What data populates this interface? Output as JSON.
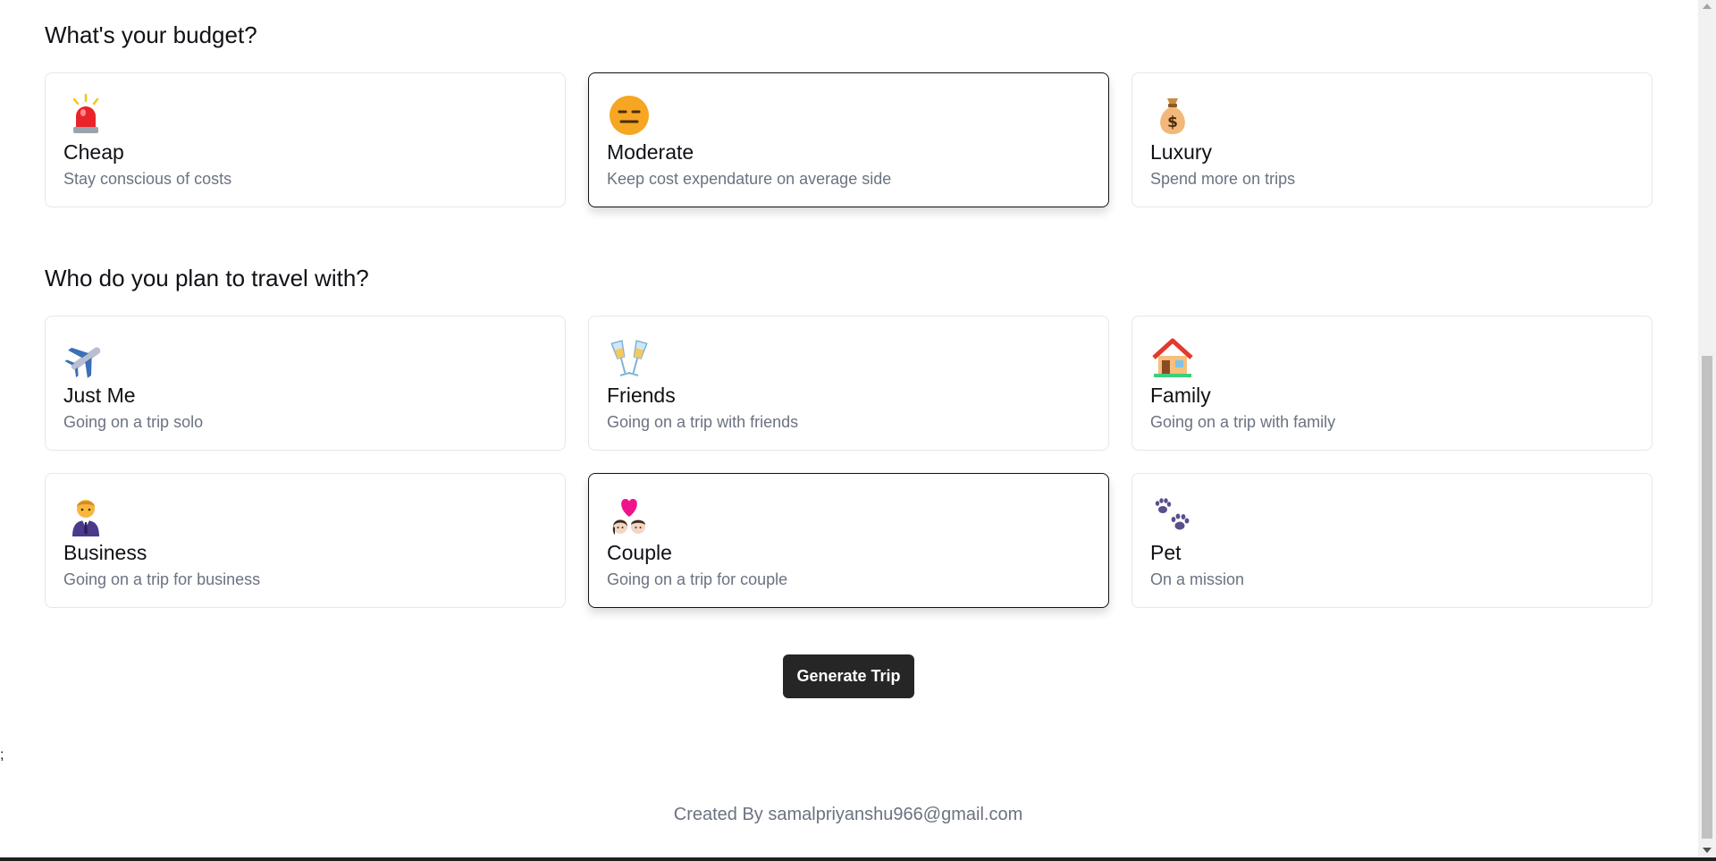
{
  "budget": {
    "title": "What's your budget?",
    "options": [
      {
        "icon": "siren-icon",
        "title": "Cheap",
        "desc": "Stay conscious of costs",
        "selected": false
      },
      {
        "icon": "neutral-face-icon",
        "title": "Moderate",
        "desc": "Keep cost expendature on average side",
        "selected": true
      },
      {
        "icon": "money-bag-icon",
        "title": "Luxury",
        "desc": "Spend more on trips",
        "selected": false
      }
    ]
  },
  "travelers": {
    "title": "Who do you plan to travel with?",
    "options": [
      {
        "icon": "airplane-icon",
        "title": "Just Me",
        "desc": "Going on a trip solo",
        "selected": false
      },
      {
        "icon": "champagne-glasses-icon",
        "title": "Friends",
        "desc": "Going on a trip with friends",
        "selected": false
      },
      {
        "icon": "house-icon",
        "title": "Family",
        "desc": "Going on a trip with family",
        "selected": false
      },
      {
        "icon": "businessperson-icon",
        "title": "Business",
        "desc": "Going on a trip for business",
        "selected": false
      },
      {
        "icon": "couple-with-heart-icon",
        "title": "Couple",
        "desc": "Going on a trip for couple",
        "selected": true
      },
      {
        "icon": "paw-prints-icon",
        "title": "Pet",
        "desc": "On a mission",
        "selected": false
      }
    ]
  },
  "generate_button": {
    "label": "Generate Trip"
  },
  "stray_text": ";",
  "footer": {
    "text": "Created By samalpriyanshu966@gmail.com"
  },
  "colors": {
    "button_bg": "#262626",
    "selected_border": "#111111",
    "card_border": "#e5e7eb",
    "muted_text": "#6b7280"
  }
}
